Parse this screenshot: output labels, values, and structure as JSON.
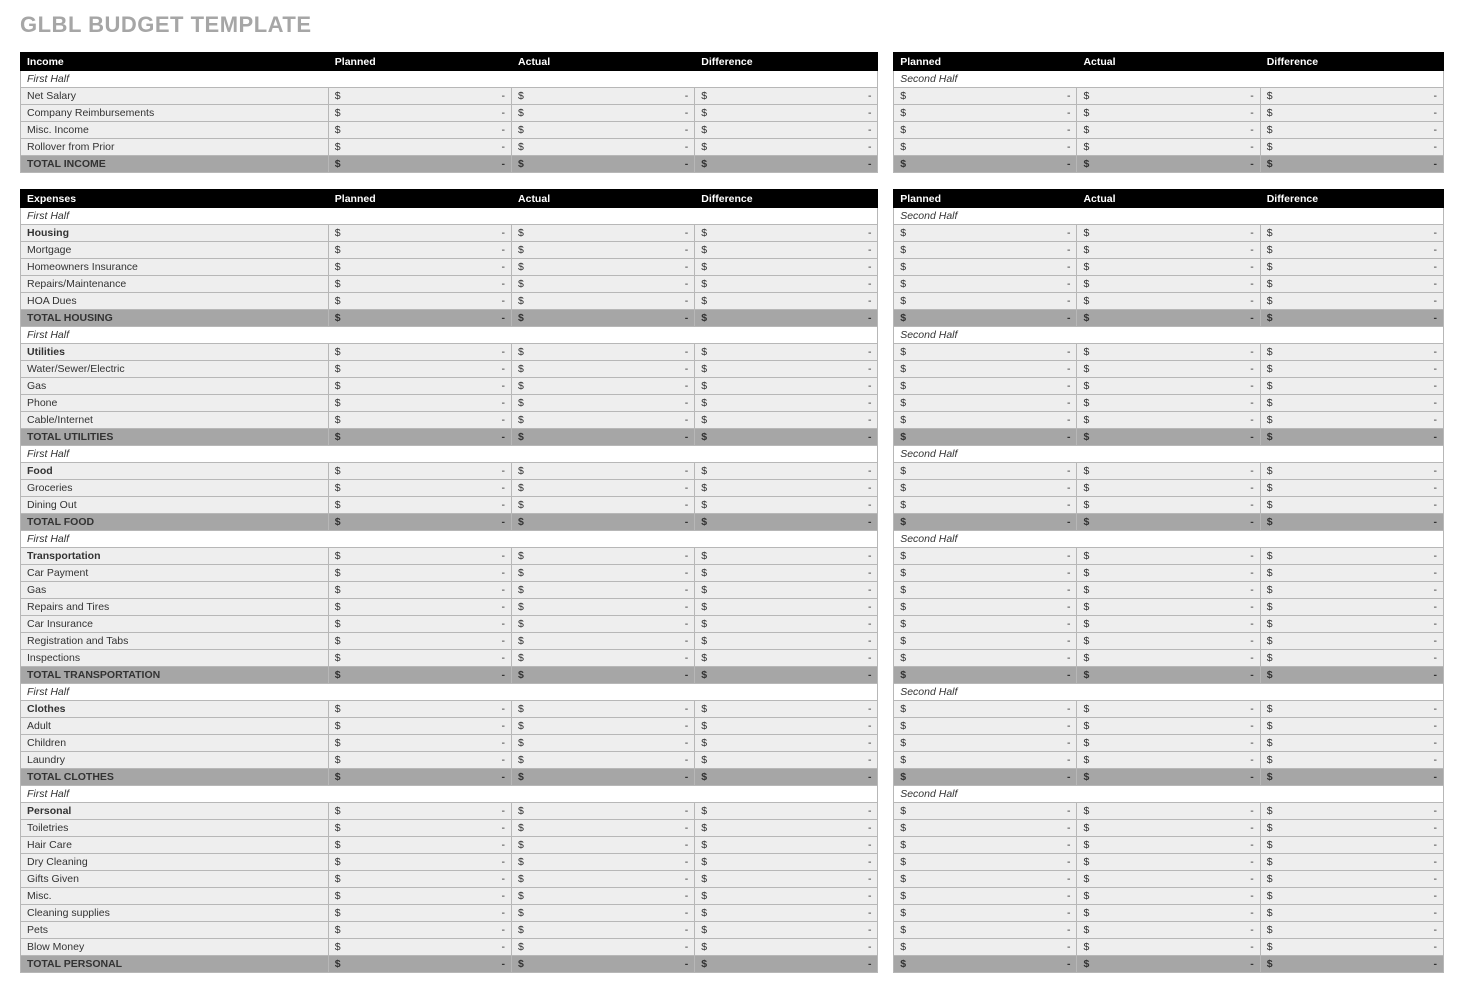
{
  "title": "GLBL BUDGET TEMPLATE",
  "columns": {
    "planned": "Planned",
    "actual": "Actual",
    "difference": "Difference"
  },
  "periods": {
    "first": "First Half",
    "second": "Second Half"
  },
  "money": {
    "symbol": "$",
    "dash": "-"
  },
  "sections": [
    {
      "header": "Income",
      "groups": [
        {
          "period": true,
          "rows": [
            {
              "label": "Net Salary"
            },
            {
              "label": "Company Reimbursements"
            },
            {
              "label": "Misc. Income"
            },
            {
              "label": "Rollover from Prior"
            }
          ],
          "total": "TOTAL INCOME"
        }
      ]
    },
    {
      "header": "Expenses",
      "groups": [
        {
          "period": true,
          "rows": [
            {
              "label": "Housing",
              "bold": true
            },
            {
              "label": "Mortgage"
            },
            {
              "label": "Homeowners Insurance"
            },
            {
              "label": "Repairs/Maintenance"
            },
            {
              "label": "HOA Dues"
            }
          ],
          "total": "TOTAL HOUSING"
        },
        {
          "period": true,
          "rows": [
            {
              "label": "Utilities",
              "bold": true
            },
            {
              "label": "Water/Sewer/Electric"
            },
            {
              "label": "Gas"
            },
            {
              "label": "Phone"
            },
            {
              "label": "Cable/Internet"
            }
          ],
          "total": "TOTAL UTILITIES"
        },
        {
          "period": true,
          "rows": [
            {
              "label": "Food",
              "bold": true
            },
            {
              "label": "Groceries"
            },
            {
              "label": "Dining Out"
            }
          ],
          "total": "TOTAL FOOD"
        },
        {
          "period": true,
          "rows": [
            {
              "label": "Transportation",
              "bold": true
            },
            {
              "label": "Car Payment"
            },
            {
              "label": "Gas"
            },
            {
              "label": "Repairs and Tires"
            },
            {
              "label": "Car Insurance"
            },
            {
              "label": "Registration and Tabs"
            },
            {
              "label": "Inspections"
            }
          ],
          "total": "TOTAL TRANSPORTATION"
        },
        {
          "period": true,
          "rows": [
            {
              "label": "Clothes",
              "bold": true
            },
            {
              "label": "Adult"
            },
            {
              "label": "Children"
            },
            {
              "label": "Laundry"
            }
          ],
          "total": "TOTAL CLOTHES"
        },
        {
          "period": true,
          "rows": [
            {
              "label": "Personal",
              "bold": true
            },
            {
              "label": "Toiletries"
            },
            {
              "label": "Hair Care"
            },
            {
              "label": "Dry Cleaning"
            },
            {
              "label": "Gifts Given"
            },
            {
              "label": "Misc."
            },
            {
              "label": "Cleaning supplies"
            },
            {
              "label": "Pets"
            },
            {
              "label": "Blow Money"
            }
          ],
          "total": "TOTAL PERSONAL"
        }
      ]
    }
  ]
}
